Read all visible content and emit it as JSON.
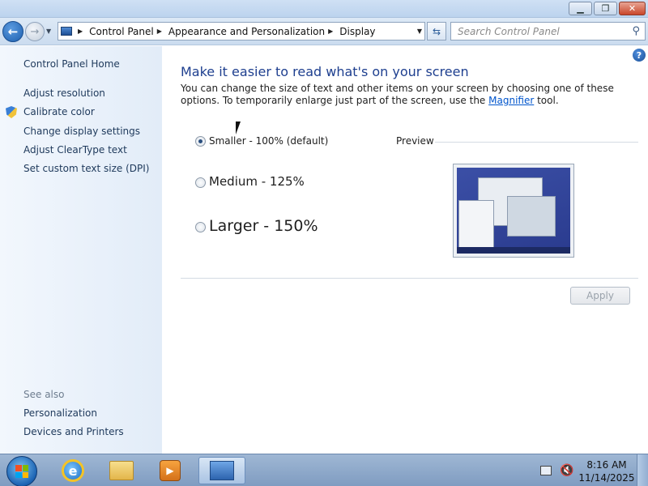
{
  "window": {
    "minimize_icon": "minimize-icon",
    "maximize_icon": "maximize-icon",
    "close_icon": "close-icon",
    "close_glyph": "✕"
  },
  "navbar": {
    "breadcrumb": [
      "Control Panel",
      "Appearance and Personalization",
      "Display"
    ],
    "search_placeholder": "Search Control Panel"
  },
  "sidebar": {
    "home": "Control Panel Home",
    "links": [
      "Adjust resolution",
      "Calibrate color",
      "Change display settings",
      "Adjust ClearType text",
      "Set custom text size (DPI)"
    ],
    "see_also_title": "See also",
    "see_also": [
      "Personalization",
      "Devices and Printers"
    ]
  },
  "main": {
    "heading": "Make it easier to read what's on your screen",
    "desc_part1": "You can change the size of text and other items on your screen by choosing one of these options. To temporarily enlarge just part of the screen, use the ",
    "desc_link": "Magnifier",
    "desc_part2": " tool.",
    "options": [
      {
        "label": "Smaller - 100% (default)",
        "selected": true
      },
      {
        "label": "Medium - 125%",
        "selected": false
      },
      {
        "label": "Larger - 150%",
        "selected": false
      }
    ],
    "preview_label": "Preview",
    "apply_label": "Apply"
  },
  "taskbar": {
    "apps": [
      "internet-explorer-icon",
      "file-explorer-icon",
      "media-player-icon",
      "control-panel-icon"
    ],
    "time": "8:16 AM",
    "date": "11/14/2025"
  }
}
